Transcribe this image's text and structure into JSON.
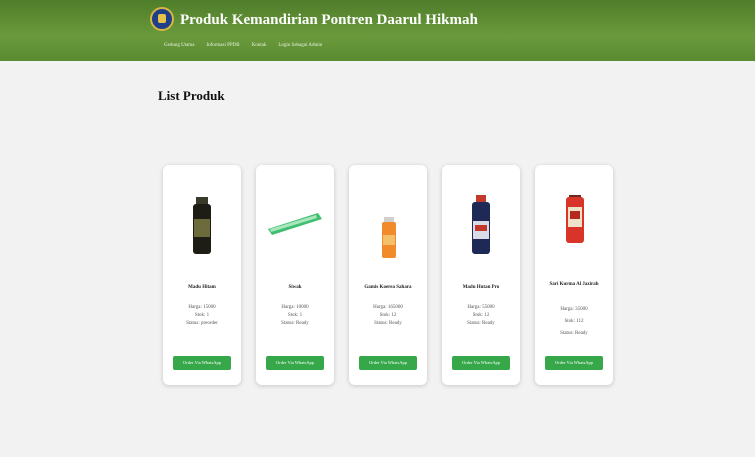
{
  "header": {
    "title": "Produk Kemandirian Pontren Daarul Hikmah",
    "nav": [
      "Gedung Utama",
      "Informasi PPDB",
      "Kontak",
      "Login Sebagai Admin"
    ]
  },
  "main": {
    "page_title": "List Produk"
  },
  "products": [
    {
      "name": "Madu Hitam",
      "harga": "Harga: 15000",
      "stok": "Stok: 1",
      "status": "Status: preorder",
      "button": "Order Via WhatsApp"
    },
    {
      "name": "Siwak",
      "harga": "Harga: 10000",
      "stok": "Stok: 1",
      "status": "Status: Ready",
      "button": "Order Via WhatsApp"
    },
    {
      "name": "Gamis Koerea Sahara",
      "harga": "Harga: 165000",
      "stok": "Stok: 12",
      "status": "Status: Ready",
      "button": "Order Via WhatsApp"
    },
    {
      "name": "Madu Hutan Pro",
      "harga": "Harga: 55000",
      "stok": "Stok: 12",
      "status": "Status: Ready",
      "button": "Order Via WhatsApp"
    },
    {
      "name": "Sari Kurma Al Jazirah",
      "harga": "Harga: 35000",
      "stok": "Stok: 112",
      "status": "Status: Ready",
      "button": "Order Via WhatsApp"
    }
  ],
  "colors": {
    "header_green": "#5a8a31",
    "button_green": "#37a84a"
  }
}
